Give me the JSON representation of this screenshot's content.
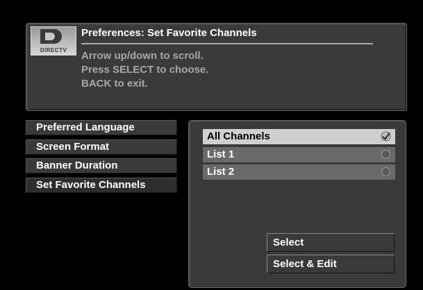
{
  "header": {
    "logo_text": "DIRECTV",
    "title": "Preferences: Set Favorite Channels",
    "instructions": [
      "Arrow up/down to scroll.",
      "Press SELECT to choose.",
      "BACK to exit."
    ]
  },
  "menu": {
    "items": [
      {
        "label": "Preferred Language"
      },
      {
        "label": "Screen Format"
      },
      {
        "label": "Banner Duration"
      },
      {
        "label": "Set Favorite Channels",
        "active": true
      }
    ]
  },
  "options": {
    "items": [
      {
        "label": "All Channels",
        "selected": true,
        "icon": "checkmark-icon"
      },
      {
        "label": "List 1",
        "selected": false,
        "icon": "radio-icon"
      },
      {
        "label": "List 2",
        "selected": false,
        "icon": "radio-icon"
      }
    ]
  },
  "actions": {
    "select_label": "Select",
    "select_edit_label": "Select & Edit"
  }
}
